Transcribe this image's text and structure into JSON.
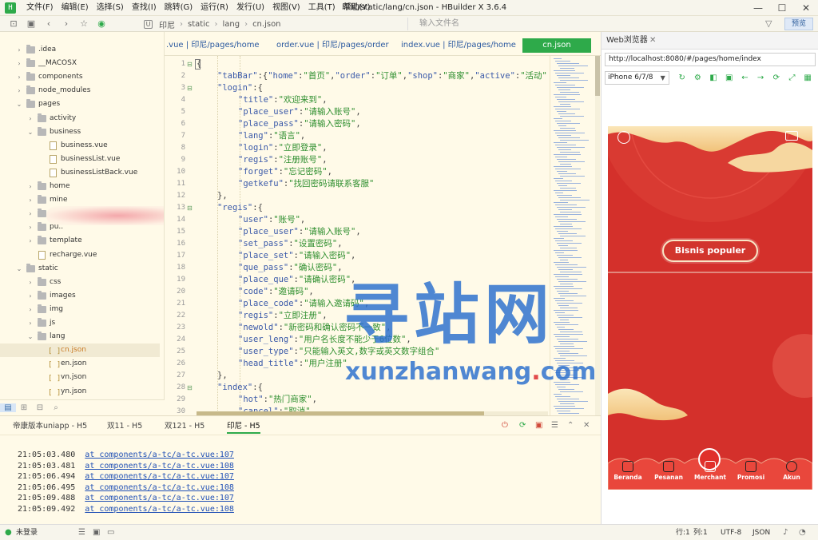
{
  "app": {
    "window_title": "印尼/static/lang/cn.json - HBuilder X 3.6.4",
    "menu": [
      "文件(F)",
      "编辑(E)",
      "选择(S)",
      "查找(I)",
      "跳转(G)",
      "运行(R)",
      "发行(U)",
      "视图(V)",
      "工具(T)",
      "帮助(Y)"
    ]
  },
  "toolbar": {
    "breadcrumb": [
      "印尼",
      "static",
      "lang",
      "cn.json"
    ],
    "search_placeholder": "输入文件名",
    "preview_label": "预览"
  },
  "sidebar": {
    "items": [
      {
        "label": ".idea",
        "type": "folder",
        "expanded": false,
        "depth": 1
      },
      {
        "label": "__MACOSX",
        "type": "folder",
        "expanded": false,
        "depth": 1
      },
      {
        "label": "components",
        "type": "folder",
        "expanded": false,
        "depth": 1
      },
      {
        "label": "node_modules",
        "type": "folder",
        "expanded": false,
        "depth": 1
      },
      {
        "label": "pages",
        "type": "folder",
        "expanded": true,
        "depth": 1
      },
      {
        "label": "activity",
        "type": "folder",
        "expanded": false,
        "depth": 2
      },
      {
        "label": "business",
        "type": "folder",
        "expanded": true,
        "depth": 2
      },
      {
        "label": "business.vue",
        "type": "vue",
        "depth": 3
      },
      {
        "label": "businessList.vue",
        "type": "vue",
        "depth": 3
      },
      {
        "label": "businessListBack.vue",
        "type": "vue",
        "depth": 3
      },
      {
        "label": "home",
        "type": "folder",
        "expanded": false,
        "depth": 2
      },
      {
        "label": "mine",
        "type": "folder",
        "expanded": false,
        "depth": 2
      },
      {
        "label": "",
        "type": "folder",
        "expanded": false,
        "depth": 2
      },
      {
        "label": "pu..",
        "type": "folder",
        "expanded": false,
        "depth": 2
      },
      {
        "label": "template",
        "type": "folder",
        "expanded": false,
        "depth": 2
      },
      {
        "label": "recharge.vue",
        "type": "vue",
        "depth": 2
      },
      {
        "label": "static",
        "type": "folder",
        "expanded": true,
        "depth": 1
      },
      {
        "label": "css",
        "type": "folder",
        "expanded": false,
        "depth": 2
      },
      {
        "label": "images",
        "type": "folder",
        "expanded": false,
        "depth": 2
      },
      {
        "label": "img",
        "type": "folder",
        "expanded": false,
        "depth": 2
      },
      {
        "label": "js",
        "type": "folder",
        "expanded": false,
        "depth": 2
      },
      {
        "label": "lang",
        "type": "folder",
        "expanded": true,
        "depth": 2
      },
      {
        "label": "cn.json",
        "type": "json",
        "depth": 3,
        "selected": true
      },
      {
        "label": "en.json",
        "type": "json",
        "depth": 3
      },
      {
        "label": "vn.json",
        "type": "json",
        "depth": 3
      },
      {
        "label": "yn.json",
        "type": "json",
        "depth": 3
      }
    ]
  },
  "tabs": [
    {
      "label": ".vue | 印尼/pages/home",
      "active": false
    },
    {
      "label": "order.vue | 印尼/pages/order",
      "active": false
    },
    {
      "label": "index.vue | 印尼/pages/home",
      "active": false
    },
    {
      "label": "cn.json",
      "active": true
    }
  ],
  "editor": {
    "lines": [
      {
        "n": "1",
        "fold": true,
        "indent": 0,
        "parts": [
          [
            "p",
            "{"
          ]
        ]
      },
      {
        "n": "2",
        "fold": false,
        "indent": 1,
        "parts": [
          [
            "k",
            "\"tabBar\""
          ],
          [
            "p",
            ":{"
          ],
          [
            "k",
            "\"home\""
          ],
          [
            "p",
            ":"
          ],
          [
            "s",
            "\"首页\""
          ],
          [
            "p",
            ","
          ],
          [
            "k",
            "\"order\""
          ],
          [
            "p",
            ":"
          ],
          [
            "s",
            "\"订单\""
          ],
          [
            "p",
            ","
          ],
          [
            "k",
            "\"shop\""
          ],
          [
            "p",
            ":"
          ],
          [
            "s",
            "\"商家\""
          ],
          [
            "p",
            ","
          ],
          [
            "k",
            "\"active\""
          ],
          [
            "p",
            ":"
          ],
          [
            "s",
            "\"活动\""
          ],
          [
            "p",
            ","
          ]
        ]
      },
      {
        "n": "3",
        "fold": true,
        "indent": 1,
        "parts": [
          [
            "k",
            "\"login\""
          ],
          [
            "p",
            ":{"
          ]
        ]
      },
      {
        "n": "4",
        "fold": false,
        "indent": 2,
        "parts": [
          [
            "k",
            "\"title\""
          ],
          [
            "p",
            ":"
          ],
          [
            "s",
            "\"欢迎来到\""
          ],
          [
            "p",
            ","
          ]
        ]
      },
      {
        "n": "5",
        "fold": false,
        "indent": 2,
        "parts": [
          [
            "k",
            "\"place_user\""
          ],
          [
            "p",
            ":"
          ],
          [
            "s",
            "\"请输入账号\""
          ],
          [
            "p",
            ","
          ]
        ]
      },
      {
        "n": "6",
        "fold": false,
        "indent": 2,
        "parts": [
          [
            "k",
            "\"place_pass\""
          ],
          [
            "p",
            ":"
          ],
          [
            "s",
            "\"请输入密码\""
          ],
          [
            "p",
            ","
          ]
        ]
      },
      {
        "n": "7",
        "fold": false,
        "indent": 2,
        "parts": [
          [
            "k",
            "\"lang\""
          ],
          [
            "p",
            ":"
          ],
          [
            "s",
            "\"语言\""
          ],
          [
            "p",
            ","
          ]
        ]
      },
      {
        "n": "8",
        "fold": false,
        "indent": 2,
        "parts": [
          [
            "k",
            "\"login\""
          ],
          [
            "p",
            ":"
          ],
          [
            "s",
            "\"立即登录\""
          ],
          [
            "p",
            ","
          ]
        ]
      },
      {
        "n": "9",
        "fold": false,
        "indent": 2,
        "parts": [
          [
            "k",
            "\"regis\""
          ],
          [
            "p",
            ":"
          ],
          [
            "s",
            "\"注册账号\""
          ],
          [
            "p",
            ","
          ]
        ]
      },
      {
        "n": "10",
        "fold": false,
        "indent": 2,
        "parts": [
          [
            "k",
            "\"forget\""
          ],
          [
            "p",
            ":"
          ],
          [
            "s",
            "\"忘记密码\""
          ],
          [
            "p",
            ","
          ]
        ]
      },
      {
        "n": "11",
        "fold": false,
        "indent": 2,
        "parts": [
          [
            "k",
            "\"getkefu\""
          ],
          [
            "p",
            ":"
          ],
          [
            "s",
            "\"找回密码请联系客服\""
          ]
        ]
      },
      {
        "n": "12",
        "fold": false,
        "indent": 1,
        "parts": [
          [
            "p",
            "},"
          ]
        ]
      },
      {
        "n": "13",
        "fold": true,
        "indent": 1,
        "parts": [
          [
            "k",
            "\"regis\""
          ],
          [
            "p",
            ":{"
          ]
        ]
      },
      {
        "n": "14",
        "fold": false,
        "indent": 2,
        "parts": [
          [
            "k",
            "\"user\""
          ],
          [
            "p",
            ":"
          ],
          [
            "s",
            "\"账号\""
          ],
          [
            "p",
            ","
          ]
        ]
      },
      {
        "n": "15",
        "fold": false,
        "indent": 2,
        "parts": [
          [
            "k",
            "\"place_user\""
          ],
          [
            "p",
            ":"
          ],
          [
            "s",
            "\"请输入账号\""
          ],
          [
            "p",
            ","
          ]
        ]
      },
      {
        "n": "16",
        "fold": false,
        "indent": 2,
        "parts": [
          [
            "k",
            "\"set_pass\""
          ],
          [
            "p",
            ":"
          ],
          [
            "s",
            "\"设置密码\""
          ],
          [
            "p",
            ","
          ]
        ]
      },
      {
        "n": "17",
        "fold": false,
        "indent": 2,
        "parts": [
          [
            "k",
            "\"place_set\""
          ],
          [
            "p",
            ":"
          ],
          [
            "s",
            "\"请输入密码\""
          ],
          [
            "p",
            ","
          ]
        ]
      },
      {
        "n": "18",
        "fold": false,
        "indent": 2,
        "parts": [
          [
            "k",
            "\"que_pass\""
          ],
          [
            "p",
            ":"
          ],
          [
            "s",
            "\"确认密码\""
          ],
          [
            "p",
            ","
          ]
        ]
      },
      {
        "n": "19",
        "fold": false,
        "indent": 2,
        "parts": [
          [
            "k",
            "\"place_que\""
          ],
          [
            "p",
            ":"
          ],
          [
            "s",
            "\"请确认密码\""
          ],
          [
            "p",
            ","
          ]
        ]
      },
      {
        "n": "20",
        "fold": false,
        "indent": 2,
        "parts": [
          [
            "k",
            "\"code\""
          ],
          [
            "p",
            ":"
          ],
          [
            "s",
            "\"邀请码\""
          ],
          [
            "p",
            ","
          ]
        ]
      },
      {
        "n": "21",
        "fold": false,
        "indent": 2,
        "parts": [
          [
            "k",
            "\"place_code\""
          ],
          [
            "p",
            ":"
          ],
          [
            "s",
            "\"请输入邀请码\""
          ],
          [
            "p",
            ","
          ]
        ]
      },
      {
        "n": "22",
        "fold": false,
        "indent": 2,
        "parts": [
          [
            "k",
            "\"regis\""
          ],
          [
            "p",
            ":"
          ],
          [
            "s",
            "\"立即注册\""
          ],
          [
            "p",
            ","
          ]
        ]
      },
      {
        "n": "23",
        "fold": false,
        "indent": 2,
        "parts": [
          [
            "k",
            "\"newold\""
          ],
          [
            "p",
            ":"
          ],
          [
            "s",
            "\"新密码和确认密码不一致\""
          ],
          [
            "p",
            ","
          ]
        ]
      },
      {
        "n": "24",
        "fold": false,
        "indent": 2,
        "parts": [
          [
            "k",
            "\"user_leng\""
          ],
          [
            "p",
            ":"
          ],
          [
            "s",
            "\"用户名长度不能少于6位数\""
          ],
          [
            "p",
            ","
          ]
        ]
      },
      {
        "n": "25",
        "fold": false,
        "indent": 2,
        "parts": [
          [
            "k",
            "\"user_type\""
          ],
          [
            "p",
            ":"
          ],
          [
            "s",
            "\"只能输入英文,数字或英文数字组合\""
          ]
        ]
      },
      {
        "n": "26",
        "fold": false,
        "indent": 2,
        "parts": [
          [
            "k",
            "\"head_title\""
          ],
          [
            "p",
            ":"
          ],
          [
            "s",
            "\"用户注册\""
          ]
        ]
      },
      {
        "n": "27",
        "fold": false,
        "indent": 1,
        "parts": [
          [
            "p",
            "},"
          ]
        ]
      },
      {
        "n": "28",
        "fold": true,
        "indent": 1,
        "parts": [
          [
            "k",
            "\"index\""
          ],
          [
            "p",
            ":{"
          ]
        ]
      },
      {
        "n": "29",
        "fold": false,
        "indent": 2,
        "parts": [
          [
            "k",
            "\"hot\""
          ],
          [
            "p",
            ":"
          ],
          [
            "s",
            "\"热门商家\""
          ],
          [
            "p",
            ","
          ]
        ]
      },
      {
        "n": "30",
        "fold": false,
        "indent": 2,
        "parts": [
          [
            "k",
            "\"cancel\""
          ],
          [
            "p",
            ":"
          ],
          [
            "s",
            "\"取消\""
          ]
        ]
      }
    ]
  },
  "preview": {
    "tab_label": "Web浏览器",
    "url": "http://localhost:8080/#/pages/home/index",
    "device": "iPhone 6/7/8",
    "popular_button": "Bisnis populer",
    "nav": [
      "Beranda",
      "Pesanan",
      "Merchant",
      "Promosi",
      "Akun"
    ]
  },
  "watermark": {
    "cn": "寻站网",
    "en": "xunzhanwang.com"
  },
  "console": {
    "tabs": [
      {
        "label": "帝康版本uniapp - H5",
        "active": false
      },
      {
        "label": "双11 - H5",
        "active": false
      },
      {
        "label": "双121 - H5",
        "active": false
      },
      {
        "label": "印尼 - H5",
        "active": true
      }
    ],
    "logs": [
      {
        "time": "21:05:03.480",
        "link": "at components/a-tc/a-tc.vue:107"
      },
      {
        "time": "21:05:03.481",
        "link": "at components/a-tc/a-tc.vue:108"
      },
      {
        "time": "21:05:06.494",
        "link": "at components/a-tc/a-tc.vue:107"
      },
      {
        "time": "21:05:06.495",
        "link": "at components/a-tc/a-tc.vue:108"
      },
      {
        "time": "21:05:09.488",
        "link": "at components/a-tc/a-tc.vue:107"
      },
      {
        "time": "21:05:09.492",
        "link": "at components/a-tc/a-tc.vue:108"
      }
    ]
  },
  "status": {
    "login": "未登录",
    "position": "行:1",
    "column": "列:1",
    "encoding": "UTF-8",
    "language": "JSON"
  },
  "colors": {
    "accent_green": "#2eaa4a",
    "editor_bg": "#fffae8",
    "phone_red": "#d4302b",
    "link_blue": "#1f4fb5",
    "watermark_blue": "#286ecd"
  }
}
